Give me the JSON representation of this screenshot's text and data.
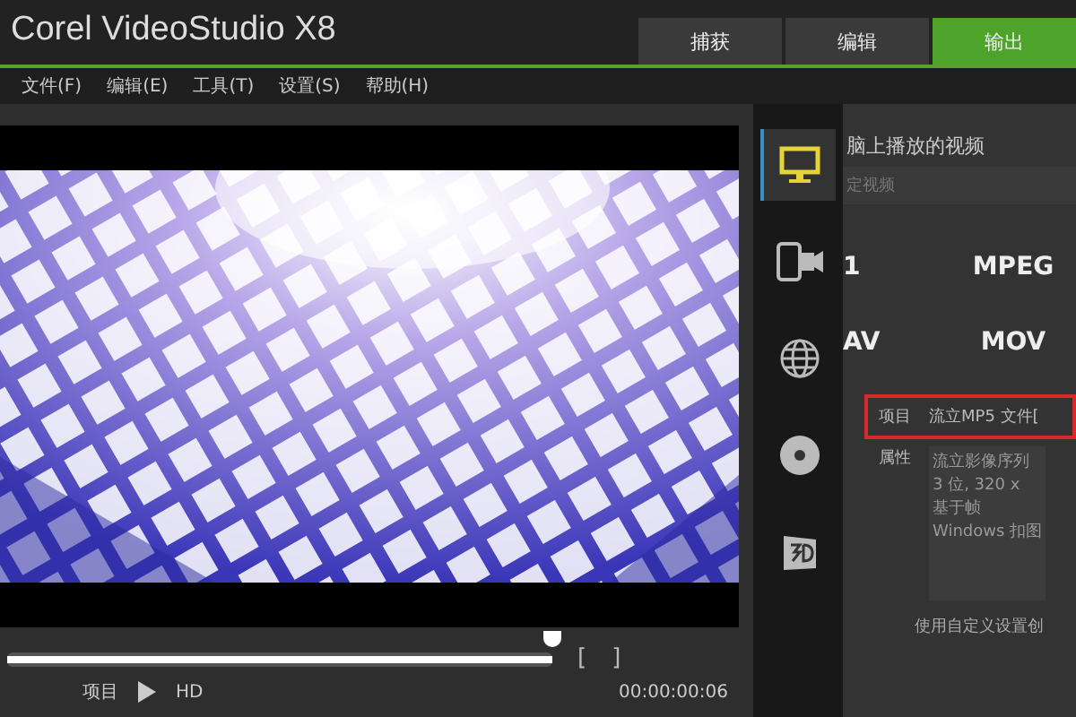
{
  "window": {
    "title": "Corel VideoStudio X8"
  },
  "tabs": [
    {
      "label": "捕获",
      "selected": false
    },
    {
      "label": "编辑",
      "selected": false
    },
    {
      "label": "输出",
      "selected": true
    }
  ],
  "menu": [
    "文件(F)",
    "编辑(E)",
    "工具(T)",
    "设置(S)",
    "帮助(H)"
  ],
  "player": {
    "level": 1,
    "marks": [
      "[",
      "]"
    ],
    "project_label": "项目",
    "hd": "HD",
    "timecode": "00:00:00:06"
  },
  "categories": [
    {
      "kind": "monitor",
      "selected": true
    },
    {
      "kind": "device",
      "selected": false
    },
    {
      "kind": "globe",
      "selected": false
    },
    {
      "kind": "disc",
      "selected": false
    },
    {
      "kind": "stereo",
      "selected": false
    }
  ],
  "panel": {
    "heading": "脑上播放的视频",
    "subheading": "定视频",
    "formats": [
      [
        "1",
        "MPEG"
      ],
      [
        "AV",
        "MOV"
      ]
    ],
    "project_label": "项目",
    "project_value": "流立MP5 文件[",
    "properties_label": "属性",
    "properties": [
      "流立影像序列",
      "3 位, 320 x",
      "基于帧",
      "Windows 扣图"
    ],
    "custom": "使用自定义设置创"
  }
}
